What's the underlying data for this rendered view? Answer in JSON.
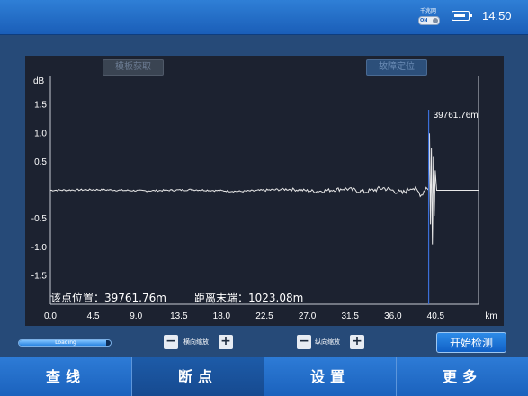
{
  "status_bar": {
    "switch_label": "千兆网",
    "switch_state": "ON",
    "time": "14:50"
  },
  "chart_buttons": {
    "template": "模板获取",
    "locate": "故障定位"
  },
  "readout": {
    "point_position": "该点位置：39761.76m",
    "distance_to_end": "距离末端：1023.08m"
  },
  "chart_data": {
    "type": "line",
    "ylabel": "dB",
    "yticks": [
      "1.5",
      "1.0",
      "0.5",
      "-0.5",
      "-1.0",
      "-1.5"
    ],
    "xlabel": "km",
    "xticks": [
      "0.0",
      "4.5",
      "9.0",
      "13.5",
      "18.0",
      "22.5",
      "27.0",
      "31.5",
      "36.0",
      "40.5"
    ],
    "xlim": [
      0,
      45
    ],
    "ylim": [
      -2,
      2
    ],
    "cursor": {
      "x_km": 39.76,
      "label": "39761.76m"
    },
    "baseline_db": 0.0,
    "series": [
      {
        "description": "reflection trace",
        "points_km_db": [
          [
            0,
            0
          ],
          [
            5,
            0.01
          ],
          [
            10,
            -0.01
          ],
          [
            15,
            0.01
          ],
          [
            20,
            -0.02
          ],
          [
            25,
            0.02
          ],
          [
            28,
            -0.02
          ],
          [
            31,
            0.03
          ],
          [
            33,
            -0.03
          ],
          [
            35,
            0.04
          ],
          [
            37,
            -0.05
          ],
          [
            38,
            0.06
          ],
          [
            39,
            -0.08
          ],
          [
            39.5,
            0.05
          ],
          [
            39.76,
            0.0
          ],
          [
            39.85,
            1.0
          ],
          [
            39.95,
            -0.6
          ],
          [
            40.05,
            0.75
          ],
          [
            40.15,
            -0.95
          ],
          [
            40.25,
            0.6
          ],
          [
            40.35,
            -0.45
          ],
          [
            40.45,
            0.35
          ],
          [
            40.6,
            0.0
          ],
          [
            45,
            0.0
          ]
        ]
      }
    ]
  },
  "controls": {
    "loading_label": "Loading",
    "loading_progress": 0.95,
    "h_zoom_label": "横向缩放",
    "v_zoom_label": "纵向缩放",
    "minus": "−",
    "plus": "+",
    "start_button": "开始检测"
  },
  "tabs": [
    {
      "label": "查线",
      "active": false
    },
    {
      "label": "断点",
      "active": true
    },
    {
      "label": "设置",
      "active": false
    },
    {
      "label": "更多",
      "active": false
    }
  ],
  "colors": {
    "trace": "#e8e8e8",
    "cursor": "#3b6fd8",
    "axis": "#c8ccd4",
    "text": "#ffffff"
  }
}
